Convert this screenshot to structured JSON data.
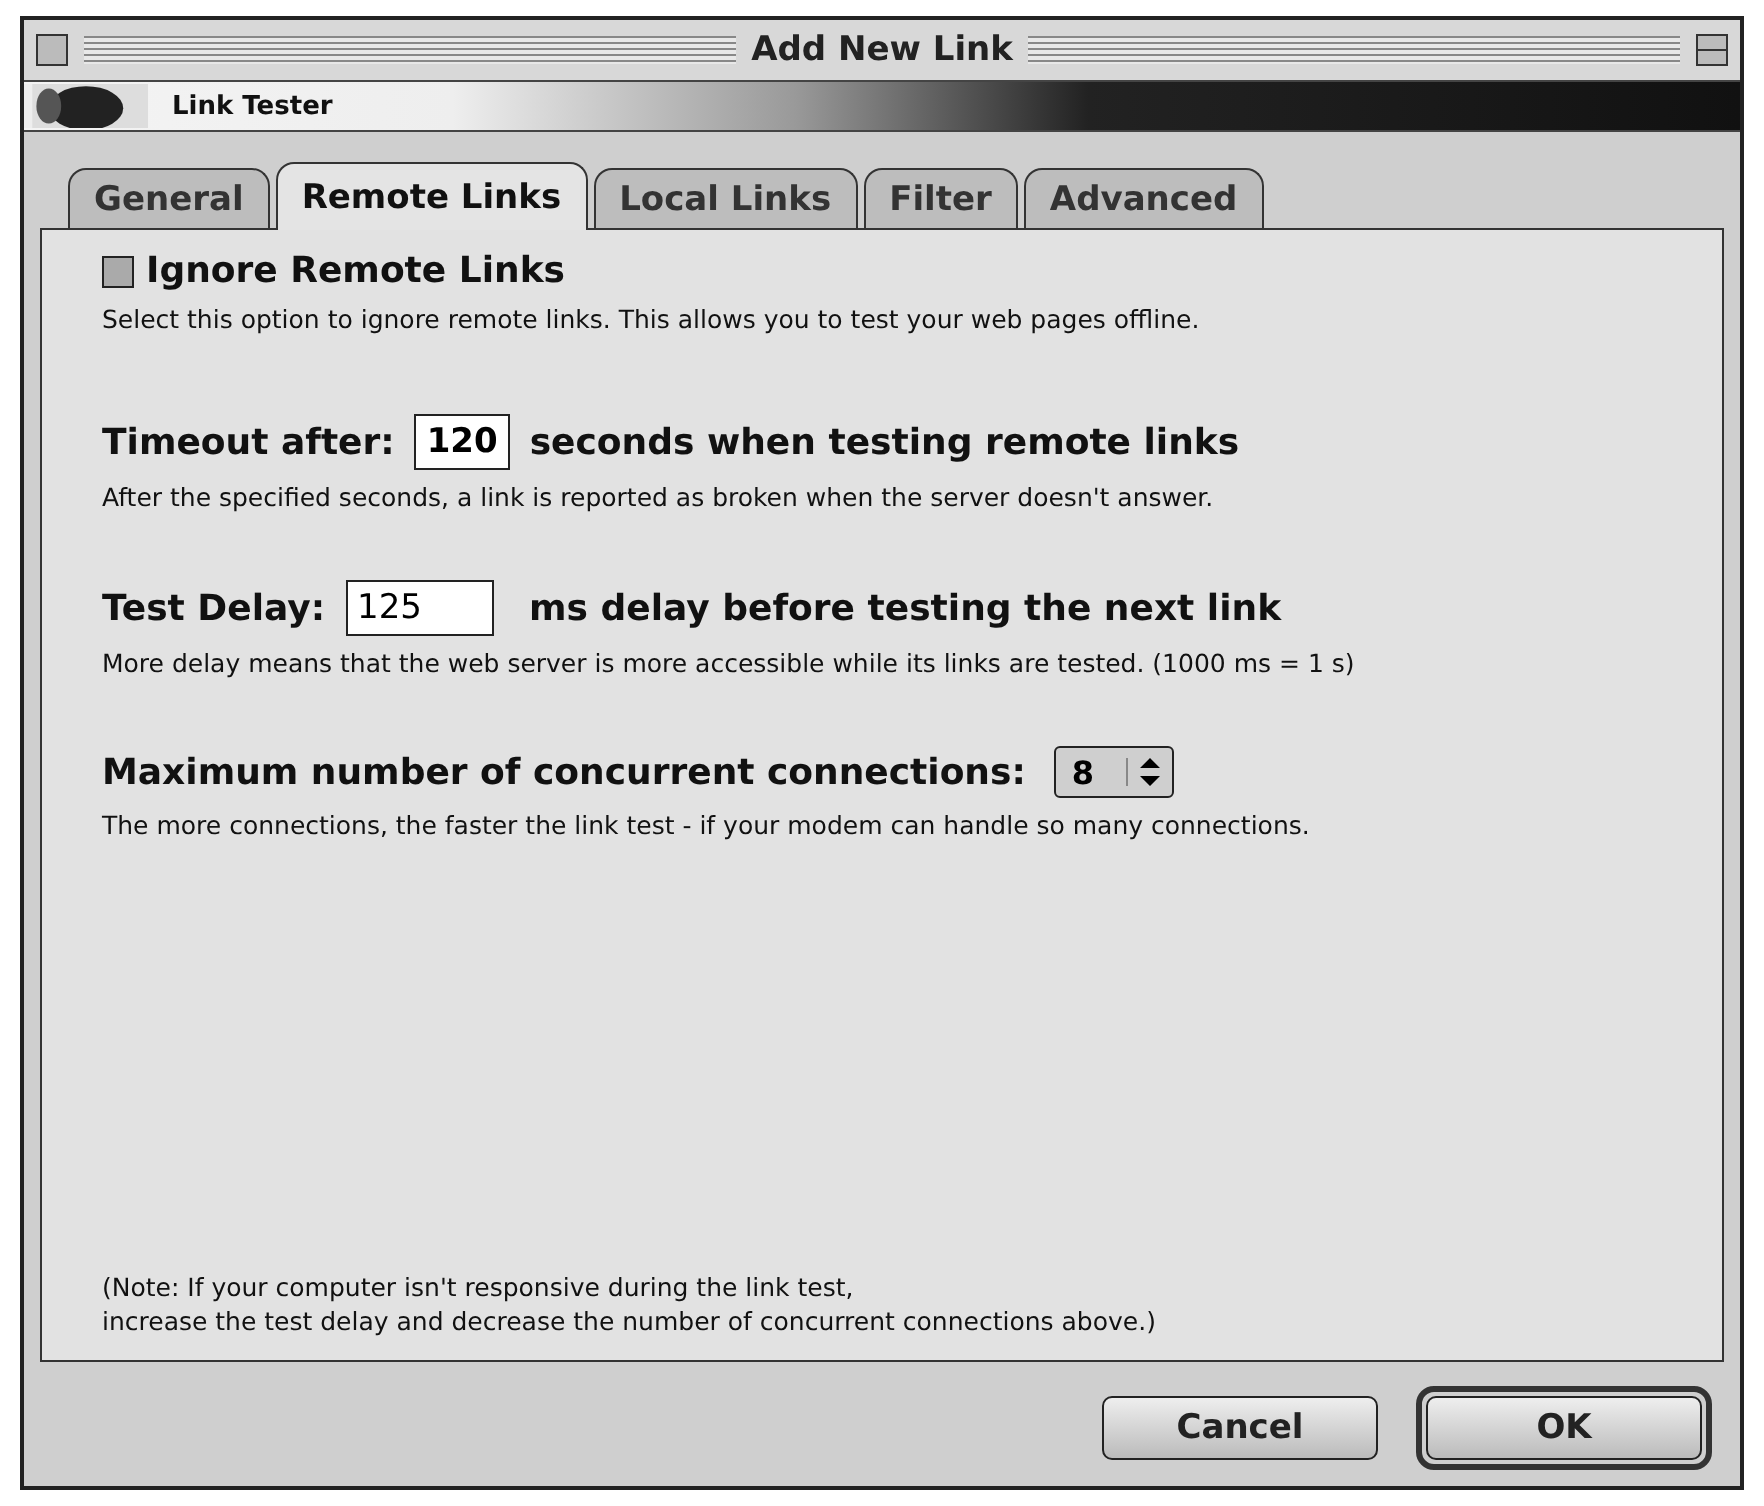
{
  "window": {
    "title": "Add New Link"
  },
  "banner": {
    "title": "Link Tester"
  },
  "tabs": [
    {
      "label": "General",
      "selected": false
    },
    {
      "label": "Remote Links",
      "selected": true
    },
    {
      "label": "Local Links",
      "selected": false
    },
    {
      "label": "Filter",
      "selected": false
    },
    {
      "label": "Advanced",
      "selected": false
    }
  ],
  "ignore_remote_links": {
    "label": "Ignore Remote Links",
    "checked": false,
    "description": "Select this option to ignore remote links. This allows you to test your web pages offline."
  },
  "timeout": {
    "label": "Timeout after:",
    "value": "120",
    "suffix": "seconds when testing remote links",
    "description": "After the specified seconds, a link is reported as broken when the server doesn't answer."
  },
  "test_delay": {
    "label": "Test Delay:",
    "value": "125",
    "suffix": "ms delay before testing the next link",
    "description": "More delay means that the web server is more accessible while its links are tested. (1000 ms = 1 s)"
  },
  "max_connections": {
    "label": "Maximum number of concurrent connections:",
    "value": "8",
    "description": "The more connections, the faster the link test - if your modem can handle so many connections."
  },
  "note": [
    "(Note: If your computer isn't responsive during the link test,",
    "increase the test delay and decrease the number of concurrent connections above.)"
  ],
  "buttons": [
    {
      "label": "Cancel",
      "default": false
    },
    {
      "label": "OK",
      "default": true
    }
  ]
}
